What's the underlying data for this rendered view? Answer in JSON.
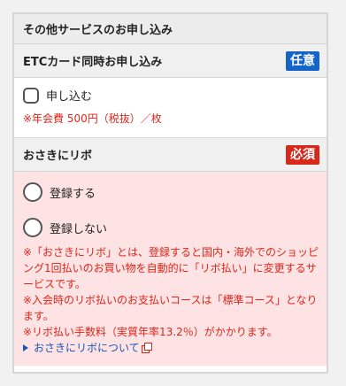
{
  "section": {
    "title": "その他サービスのお申し込み"
  },
  "etc_card": {
    "label": "ETCカード同時お申し込み",
    "badge": "任意",
    "option_label": "申し込む",
    "fee_note": "※年会費 500円（税抜）／枚"
  },
  "ribo": {
    "label": "おさきにリボ",
    "badge": "必須",
    "options": [
      {
        "label": "登録する",
        "checked": false
      },
      {
        "label": "登録しない",
        "checked": false
      }
    ],
    "notes": [
      "※「おさきにリボ」とは、登録すると国内・海外でのショッピング1回払いのお買い物を自動的に「リボ払い」に変更するサービスです。",
      "※入会時のリボ払いのお支払いコースは「標準コース」となります。",
      "※リボ払い手数料（実質年率13.2％）がかかります。"
    ],
    "link_label": "おさきにリボについて"
  },
  "colors": {
    "optional_badge": "#1565c8",
    "required_badge": "#d7281c",
    "note_red": "#e0261b",
    "pink_panel": "#fde3e3",
    "link_blue": "#1a56b8"
  },
  "icons": {
    "link_marker": "triangle-right-icon",
    "external": "external-link-icon"
  }
}
